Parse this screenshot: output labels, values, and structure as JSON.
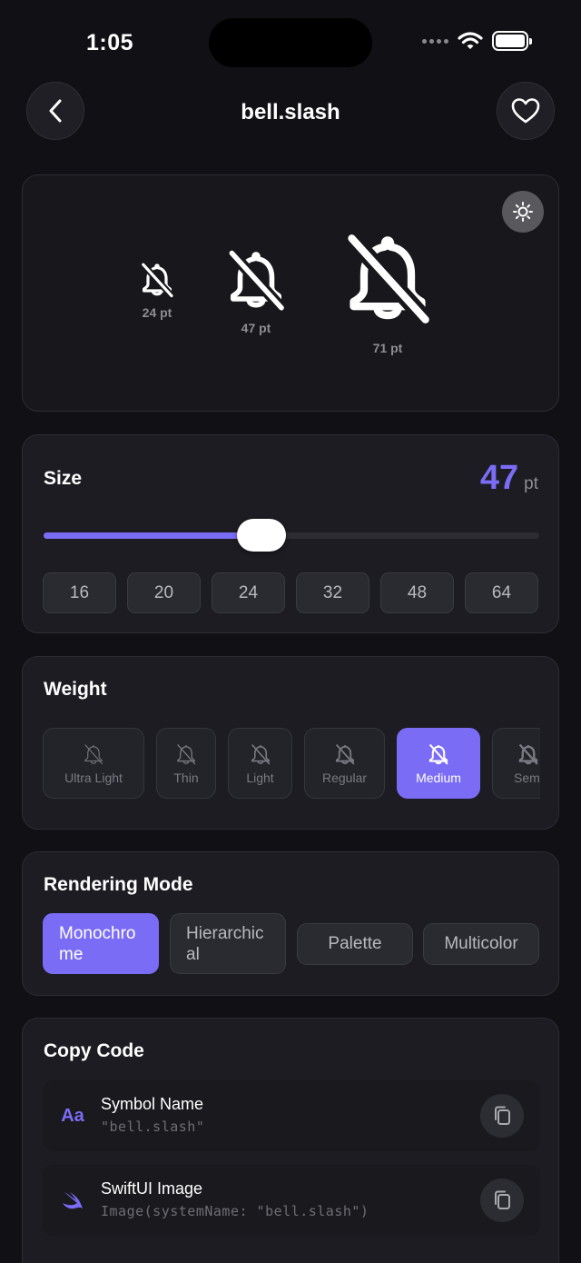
{
  "status": {
    "time": "1:05"
  },
  "nav": {
    "title": "bell.slash"
  },
  "preview": {
    "items": [
      {
        "label": "24 pt"
      },
      {
        "label": "47 pt"
      },
      {
        "label": "71 pt"
      }
    ]
  },
  "size": {
    "title": "Size",
    "value": "47",
    "unit": "pt",
    "slider_fraction": 0.44,
    "presets": [
      "16",
      "20",
      "24",
      "32",
      "48",
      "64"
    ]
  },
  "weight": {
    "title": "Weight",
    "options": [
      "Ultra Light",
      "Thin",
      "Light",
      "Regular",
      "Medium",
      "Semi"
    ],
    "selected": "Medium"
  },
  "rendering": {
    "title": "Rendering Mode",
    "options": [
      "Monochro\nme",
      "Hierarchic\nal",
      "Palette",
      "Multicolor"
    ],
    "selected": "Monochro\nme"
  },
  "copy_code": {
    "title": "Copy Code",
    "rows": [
      {
        "icon_text": "Aa",
        "name": "Symbol Name",
        "value": "\"bell.slash\""
      },
      {
        "name": "SwiftUI Image",
        "value": "Image(systemName: \"bell.slash\")"
      }
    ]
  },
  "colors": {
    "accent": "#7b6cf6",
    "background": "#111115",
    "card": "#1c1c22"
  },
  "icons": [
    "chevron-left-icon",
    "heart-icon",
    "sun-icon",
    "bell-slash-icon",
    "copy-icon",
    "swift-icon"
  ]
}
